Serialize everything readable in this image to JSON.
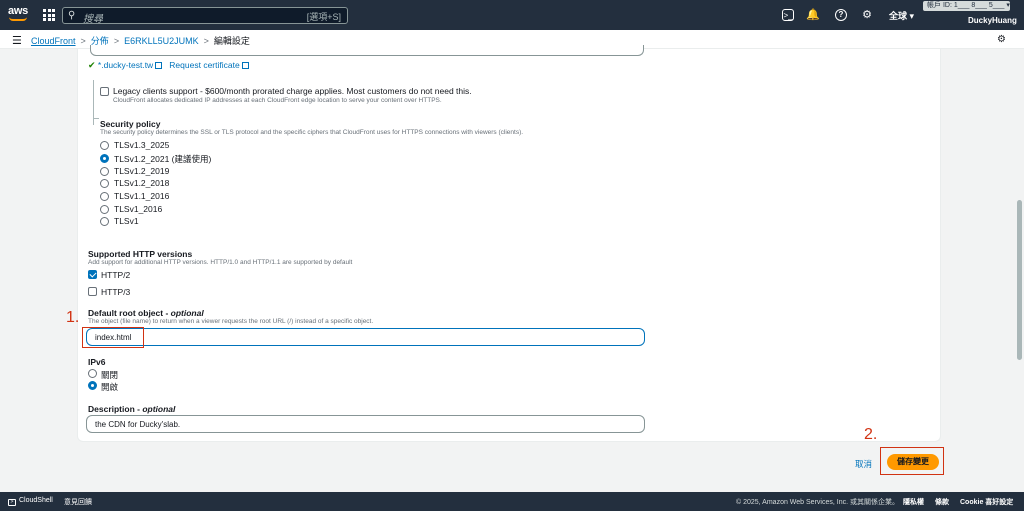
{
  "topnav": {
    "logo_text": "aws",
    "search_placeholder": "搜尋",
    "search_shortcut": "[選項+S]",
    "region": "全球 ▾",
    "account": "帳戶 ID: 1___ 8___ 5___ ▾",
    "user": "DuckyHuang"
  },
  "breadcrumb": {
    "items": [
      "CloudFront",
      "分佈",
      "E6RKLL5U2JUMK"
    ],
    "current": "編輯設定"
  },
  "certificate": {
    "name": "*.ducky-test.tw",
    "request_link": "Request certificate"
  },
  "legacy": {
    "label": "Legacy clients support - $600/month prorated charge applies. Most customers do not need this.",
    "desc": "CloudFront allocates dedicated IP addresses at each CloudFront edge location to serve your content over HTTPS."
  },
  "security_policy": {
    "label": "Security policy",
    "desc": "The security policy determines the SSL or TLS protocol and the specific ciphers that CloudFront uses for HTTPS connections with viewers (clients).",
    "options": [
      "TLSv1.3_2025",
      "TLSv1.2_2021 (建議使用)",
      "TLSv1.2_2019",
      "TLSv1.2_2018",
      "TLSv1.1_2016",
      "TLSv1_2016",
      "TLSv1"
    ],
    "selected_index": 1
  },
  "http_versions": {
    "label": "Supported HTTP versions",
    "desc": "Add support for additional HTTP versions. HTTP/1.0 and HTTP/1.1 are supported by default",
    "http2": "HTTP/2",
    "http3": "HTTP/3",
    "http2_checked": true,
    "http3_checked": false
  },
  "root_object": {
    "label": "Default root object - ",
    "label_optional": "optional",
    "desc": "The object (file name) to return when a viewer requests the root URL (/) instead of a specific object.",
    "value": "index.html"
  },
  "ipv6": {
    "label": "IPv6",
    "off": "關閉",
    "on": "開啟",
    "selected": "on"
  },
  "description": {
    "label": "Description - ",
    "label_optional": "optional",
    "value": "the CDN for Ducky'slab."
  },
  "annotations": {
    "one": "1.",
    "two": "2."
  },
  "actions": {
    "cancel": "取消",
    "save": "儲存變更"
  },
  "footer": {
    "cloudshell": "CloudShell",
    "feedback": "意見回饋",
    "copyright": "© 2025, Amazon Web Services, Inc. 或其關係企業。",
    "privacy": "隱私權",
    "terms": "條款",
    "cookie": "Cookie 喜好設定"
  }
}
